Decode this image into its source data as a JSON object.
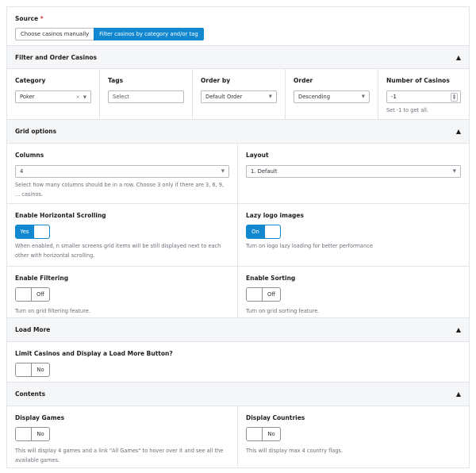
{
  "source": {
    "label": "Source",
    "required_mark": "*",
    "options": [
      "Choose casinos manually",
      "Filter casinos by category and/or tag"
    ],
    "selected": "Filter casinos by category and/or tag"
  },
  "filter_section": {
    "title": "Filter and Order Casinos",
    "category": {
      "label": "Category",
      "value": "Poker"
    },
    "tags": {
      "label": "Tags",
      "placeholder": "Select"
    },
    "order_by": {
      "label": "Order by",
      "value": "Default Order"
    },
    "order": {
      "label": "Order",
      "value": "Descending"
    },
    "number": {
      "label": "Number of Casinos",
      "value": "-1",
      "help": "Set -1 to get all."
    }
  },
  "grid_section": {
    "title": "Grid options",
    "columns": {
      "label": "Columns",
      "value": "4",
      "help": "Select how many columns should be in a row. Choose 3 only if there are 3, 6, 9, ... casinos."
    },
    "layout": {
      "label": "Layout",
      "value": "1. Default"
    },
    "horizontal_scrolling": {
      "label": "Enable Horizontal Scrolling",
      "state": "Yes",
      "help": "When enabled, n smaller screens grid items will be still displayed next to each other with horizontal scrolling."
    },
    "lazy_logo": {
      "label": "Lazy logo images",
      "state": "On",
      "help": "Turn on logo lazy loading for better performance"
    },
    "filtering": {
      "label": "Enable Filtering",
      "state": "Off",
      "help": "Turn on grid filtering feature."
    },
    "sorting": {
      "label": "Enable Sorting",
      "state": "Off",
      "help": "Turn on grid sorting feature."
    }
  },
  "load_more_section": {
    "title": "Load More",
    "limit": {
      "label": "Limit Casinos and Display a Load More Button?",
      "state": "No"
    }
  },
  "contents_section": {
    "title": "Contents",
    "games": {
      "label": "Display Games",
      "state": "No",
      "help": "This will display 4 games and a link \"All Games\" to hover over it and see all the available games."
    },
    "countries": {
      "label": "Display Countries",
      "state": "No",
      "help": "This will display max 4 country flags."
    }
  }
}
